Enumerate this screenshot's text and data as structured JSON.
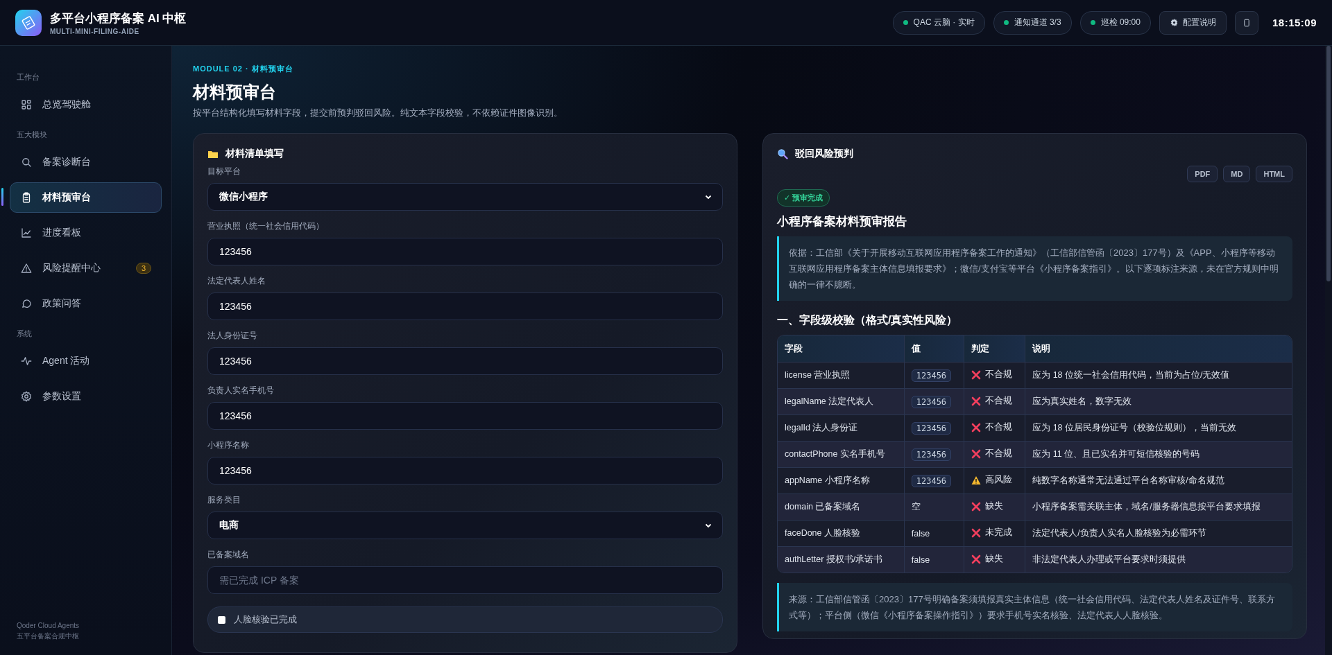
{
  "app": {
    "title": "多平台小程序备案 AI 中枢",
    "subtitle": "MULTI-MINI-FILING-AIDE"
  },
  "status_pills": [
    {
      "label": "QAC 云脑 · 实时"
    },
    {
      "label": "通知通道 3/3"
    },
    {
      "label": "巡检 09:00"
    }
  ],
  "config_button": {
    "label": "配置说明"
  },
  "clock": "18:15:09",
  "sidebar": {
    "sections": [
      {
        "title": "工作台",
        "items": [
          {
            "label": "总览驾驶舱",
            "selected": false
          }
        ]
      },
      {
        "title": "五大模块",
        "items": [
          {
            "label": "备案诊断台",
            "selected": false
          },
          {
            "label": "材料预审台",
            "selected": true
          },
          {
            "label": "进度看板",
            "selected": false
          },
          {
            "label": "风险提醒中心",
            "selected": false,
            "badge": "3"
          },
          {
            "label": "政策问答",
            "selected": false
          }
        ]
      },
      {
        "title": "系统",
        "items": [
          {
            "label": "Agent 活动",
            "selected": false
          },
          {
            "label": "参数设置",
            "selected": false
          }
        ]
      }
    ],
    "footer": [
      "Qoder Cloud Agents",
      "五平台备案合规中枢"
    ]
  },
  "page": {
    "eyebrow": "MODULE 02 · 材料预审台",
    "title": "材料预审台",
    "description": "按平台结构化填写材料字段，提交前预判驳回风险。纯文本字段校验，不依赖证件图像识别。"
  },
  "form": {
    "title": "材料清单填写",
    "fields": [
      {
        "kind": "select",
        "label": "目标平台",
        "value": "微信小程序"
      },
      {
        "kind": "input",
        "label": "营业执照（统一社会信用代码）",
        "value": "123456"
      },
      {
        "kind": "input",
        "label": "法定代表人姓名",
        "value": "123456"
      },
      {
        "kind": "input",
        "label": "法人身份证号",
        "value": "123456"
      },
      {
        "kind": "input",
        "label": "负责人实名手机号",
        "value": "123456"
      },
      {
        "kind": "input",
        "label": "小程序名称",
        "value": "123456"
      },
      {
        "kind": "select",
        "label": "服务类目",
        "value": "电商"
      },
      {
        "kind": "input",
        "label": "已备案域名",
        "placeholder": "需已完成 ICP 备案"
      },
      {
        "kind": "checkbox",
        "label": "人脸核验已完成",
        "checked": false
      }
    ]
  },
  "report": {
    "title": "驳回风险预判",
    "exports": [
      "PDF",
      "MD",
      "HTML"
    ],
    "status": "✓ 预审完成",
    "heading": "小程序备案材料预审报告",
    "basis": "依据：工信部《关于开展移动互联网应用程序备案工作的通知》（工信部信管函〔2023〕177号）及《APP、小程序等移动互联网应用程序备案主体信息填报要求》；微信/支付宝等平台《小程序备案指引》。以下逐项标注来源，未在官方规则中明确的一律不臆断。",
    "section": "一、字段级校验（格式/真实性风险）",
    "table": {
      "columns": [
        "字段",
        "值",
        "判定",
        "说明"
      ],
      "rows": [
        {
          "field": "license 营业执照",
          "value": {
            "text": "123456",
            "kind": "chip"
          },
          "verdict": {
            "text": "不合规",
            "kind": "fail"
          },
          "note": "应为 18 位统一社会信用代码，当前为占位/无效值"
        },
        {
          "field": "legalName 法定代表人",
          "value": {
            "text": "123456",
            "kind": "chip"
          },
          "verdict": {
            "text": "不合规",
            "kind": "fail"
          },
          "note": "应为真实姓名，数字无效"
        },
        {
          "field": "legalId 法人身份证",
          "value": {
            "text": "123456",
            "kind": "chip"
          },
          "verdict": {
            "text": "不合规",
            "kind": "fail"
          },
          "note": "应为 18 位居民身份证号（校验位规则），当前无效"
        },
        {
          "field": "contactPhone 实名手机号",
          "value": {
            "text": "123456",
            "kind": "chip"
          },
          "verdict": {
            "text": "不合规",
            "kind": "fail"
          },
          "note": "应为 11 位、且已实名并可短信核验的号码"
        },
        {
          "field": "appName 小程序名称",
          "value": {
            "text": "123456",
            "kind": "chip"
          },
          "verdict": {
            "text": "高风险",
            "kind": "warn"
          },
          "note": "纯数字名称通常无法通过平台名称审核/命名规范"
        },
        {
          "field": "domain 已备案域名",
          "value": {
            "text": "空",
            "kind": "plain"
          },
          "verdict": {
            "text": "缺失",
            "kind": "fail"
          },
          "note": "小程序备案需关联主体，域名/服务器信息按平台要求填报"
        },
        {
          "field": "faceDone 人脸核验",
          "value": {
            "text": "false",
            "kind": "plain"
          },
          "verdict": {
            "text": "未完成",
            "kind": "fail"
          },
          "note": "法定代表人/负责人实名人脸核验为必需环节"
        },
        {
          "field": "authLetter 授权书/承诺书",
          "value": {
            "text": "false",
            "kind": "plain"
          },
          "verdict": {
            "text": "缺失",
            "kind": "fail"
          },
          "note": "非法定代表人办理或平台要求时须提供"
        }
      ]
    },
    "source": "来源：工信部信管函〔2023〕177号明确备案须填报真实主体信息（统一社会信用代码、法定代表人姓名及证件号、联系方式等）；平台侧（微信《小程序备案操作指引》）要求手机号实名核验、法定代表人人脸核验。"
  }
}
